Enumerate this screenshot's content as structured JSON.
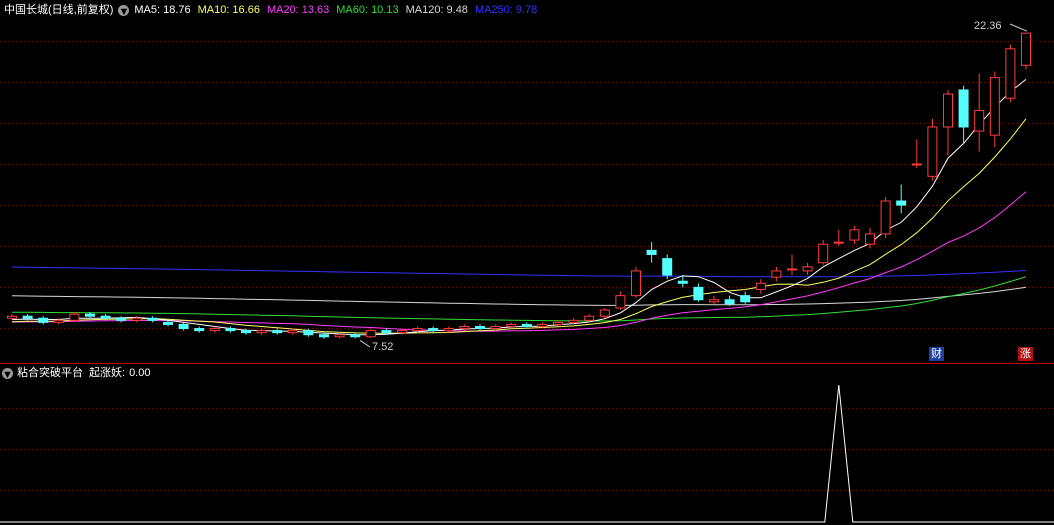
{
  "main_header": {
    "title": "中国长城(日线,前复权)",
    "ma": [
      {
        "label": "MA5:",
        "value": "18.76",
        "color": "#ffffff"
      },
      {
        "label": "MA10:",
        "value": "16.66",
        "color": "#ffff66"
      },
      {
        "label": "MA20:",
        "value": "13.63",
        "color": "#ff3cff"
      },
      {
        "label": "MA60:",
        "value": "10.13",
        "color": "#33dd33"
      },
      {
        "label": "MA120:",
        "value": "9.48",
        "color": "#d8d8d8"
      },
      {
        "label": "MA250:",
        "value": "9.78",
        "color": "#3333ff"
      }
    ]
  },
  "annotations": {
    "high_label": "22.36",
    "low_label": "7.52",
    "badge_cai": "财",
    "badge_zhang": "涨"
  },
  "sub_header": {
    "title": "粘合突破平台",
    "indicator_label": "起涨妖:",
    "indicator_value": "0.00"
  },
  "colors": {
    "up": "#ff3c3c",
    "down": "#54ffff",
    "grid": "#7a0000",
    "divider": "#c00000"
  },
  "chart_data": [
    {
      "type": "candlestick",
      "title": "中国长城(日线,前复权)",
      "series": [
        {
          "name": "MA5",
          "value_label": "18.76"
        },
        {
          "name": "MA10",
          "value_label": "16.66"
        },
        {
          "name": "MA20",
          "value_label": "13.63"
        },
        {
          "name": "MA60",
          "value_label": "10.13"
        },
        {
          "name": "MA120",
          "value_label": "9.48"
        },
        {
          "name": "MA250",
          "value_label": "9.78"
        }
      ],
      "ylim": [
        7.2,
        23.0
      ],
      "grid": true,
      "candles": [
        [
          8.5,
          8.6,
          8.7,
          8.4
        ],
        [
          8.6,
          8.5,
          8.7,
          8.4
        ],
        [
          8.5,
          8.3,
          8.6,
          8.2
        ],
        [
          8.3,
          8.4,
          8.5,
          8.2
        ],
        [
          8.4,
          8.7,
          8.8,
          8.3
        ],
        [
          8.7,
          8.6,
          8.8,
          8.5
        ],
        [
          8.6,
          8.5,
          8.7,
          8.4
        ],
        [
          8.5,
          8.4,
          8.6,
          8.3
        ],
        [
          8.4,
          8.5,
          8.6,
          8.3
        ],
        [
          8.5,
          8.4,
          8.6,
          8.3
        ],
        [
          8.3,
          8.2,
          8.4,
          8.1
        ],
        [
          8.2,
          8.0,
          8.3,
          7.9
        ],
        [
          8.0,
          7.9,
          8.1,
          7.8
        ],
        [
          7.9,
          8.0,
          8.1,
          7.8
        ],
        [
          8.0,
          7.9,
          8.1,
          7.8
        ],
        [
          7.9,
          7.8,
          8.0,
          7.7
        ],
        [
          7.8,
          7.9,
          8.0,
          7.7
        ],
        [
          7.9,
          7.8,
          8.0,
          7.7
        ],
        [
          7.8,
          7.9,
          8.0,
          7.7
        ],
        [
          7.9,
          7.7,
          8.0,
          7.6
        ],
        [
          7.7,
          7.6,
          7.8,
          7.5
        ],
        [
          7.6,
          7.7,
          7.8,
          7.52
        ],
        [
          7.7,
          7.6,
          7.8,
          7.52
        ],
        [
          7.6,
          7.9,
          8.0,
          7.55
        ],
        [
          7.9,
          7.8,
          8.0,
          7.7
        ],
        [
          7.8,
          7.9,
          8.0,
          7.7
        ],
        [
          7.9,
          8.0,
          8.1,
          7.8
        ],
        [
          8.0,
          7.9,
          8.1,
          7.8
        ],
        [
          7.9,
          8.0,
          8.1,
          7.8
        ],
        [
          8.0,
          8.1,
          8.2,
          7.9
        ],
        [
          8.1,
          8.0,
          8.2,
          7.9
        ],
        [
          8.0,
          8.1,
          8.2,
          7.9
        ],
        [
          8.1,
          8.2,
          8.3,
          8.0
        ],
        [
          8.2,
          8.1,
          8.3,
          8.0
        ],
        [
          8.1,
          8.2,
          8.3,
          8.0
        ],
        [
          8.2,
          8.3,
          8.4,
          8.1
        ],
        [
          8.3,
          8.4,
          8.5,
          8.2
        ],
        [
          8.4,
          8.6,
          8.7,
          8.3
        ],
        [
          8.6,
          8.9,
          9.0,
          8.5
        ],
        [
          9.0,
          9.6,
          9.8,
          8.9
        ],
        [
          9.6,
          10.8,
          11.0,
          9.5
        ],
        [
          11.8,
          11.6,
          12.2,
          11.2
        ],
        [
          11.4,
          10.6,
          11.6,
          10.4
        ],
        [
          10.3,
          10.2,
          10.6,
          10.0
        ],
        [
          10.0,
          9.4,
          10.2,
          9.3
        ],
        [
          9.3,
          9.4,
          9.6,
          9.2
        ],
        [
          9.4,
          9.2,
          9.6,
          9.1
        ],
        [
          9.6,
          9.3,
          9.8,
          9.2
        ],
        [
          9.9,
          10.2,
          10.4,
          9.7
        ],
        [
          10.5,
          10.8,
          11.0,
          10.3
        ],
        [
          10.9,
          10.9,
          11.6,
          10.6
        ],
        [
          10.8,
          11.0,
          11.2,
          10.6
        ],
        [
          11.2,
          12.1,
          12.3,
          11.1
        ],
        [
          12.2,
          12.2,
          12.8,
          12.0
        ],
        [
          12.3,
          12.8,
          13.0,
          12.1
        ],
        [
          12.1,
          12.6,
          12.9,
          11.9
        ],
        [
          12.6,
          14.2,
          14.4,
          12.4
        ],
        [
          14.2,
          14.0,
          15.0,
          13.6
        ],
        [
          16.0,
          16.0,
          17.2,
          15.8
        ],
        [
          15.4,
          17.8,
          18.2,
          15.2
        ],
        [
          17.8,
          19.4,
          19.6,
          16.4
        ],
        [
          19.6,
          17.8,
          19.8,
          17.0
        ],
        [
          17.6,
          18.6,
          20.4,
          16.6
        ],
        [
          17.4,
          20.2,
          20.5,
          16.8
        ],
        [
          19.2,
          21.6,
          21.8,
          19.0
        ],
        [
          20.8,
          22.36,
          22.36,
          20.6
        ]
      ]
    },
    {
      "type": "line",
      "title": "粘合突破平台",
      "series": [
        {
          "name": "起涨妖",
          "value_label": "0.00"
        }
      ],
      "ylim": [
        0,
        1
      ],
      "spike_at_candle": 53,
      "spike_value": 1
    }
  ]
}
